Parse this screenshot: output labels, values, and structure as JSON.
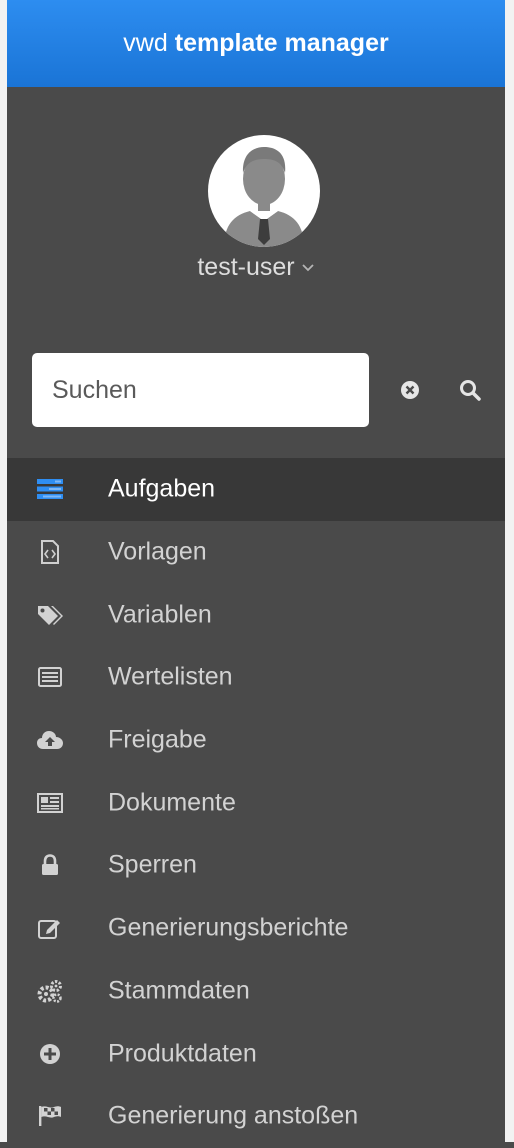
{
  "header": {
    "brand_light": "vwd",
    "brand_bold": "template manager"
  },
  "user": {
    "name": "test-user"
  },
  "search": {
    "placeholder": "Suchen",
    "value": ""
  },
  "colors": {
    "accent": "#1a74d6",
    "sidebar_bg": "#4a4a4a",
    "active_bg": "#383838",
    "active_icon": "#2f8ef2"
  },
  "nav": {
    "items": [
      {
        "label": "Aufgaben",
        "icon": "tasks-icon",
        "active": true
      },
      {
        "label": "Vorlagen",
        "icon": "file-code-icon",
        "active": false
      },
      {
        "label": "Variablen",
        "icon": "tags-icon",
        "active": false
      },
      {
        "label": "Wertelisten",
        "icon": "list-alt-icon",
        "active": false
      },
      {
        "label": "Freigabe",
        "icon": "cloud-upload-icon",
        "active": false
      },
      {
        "label": "Dokumente",
        "icon": "newspaper-icon",
        "active": false
      },
      {
        "label": "Sperren",
        "icon": "lock-icon",
        "active": false
      },
      {
        "label": "Generierungsberichte",
        "icon": "edit-icon",
        "active": false
      },
      {
        "label": "Stammdaten",
        "icon": "cogs-icon",
        "active": false
      },
      {
        "label": "Produktdaten",
        "icon": "plus-circle-icon",
        "active": false
      },
      {
        "label": "Generierung anstoßen",
        "icon": "flag-checkered-icon",
        "active": false
      }
    ]
  }
}
